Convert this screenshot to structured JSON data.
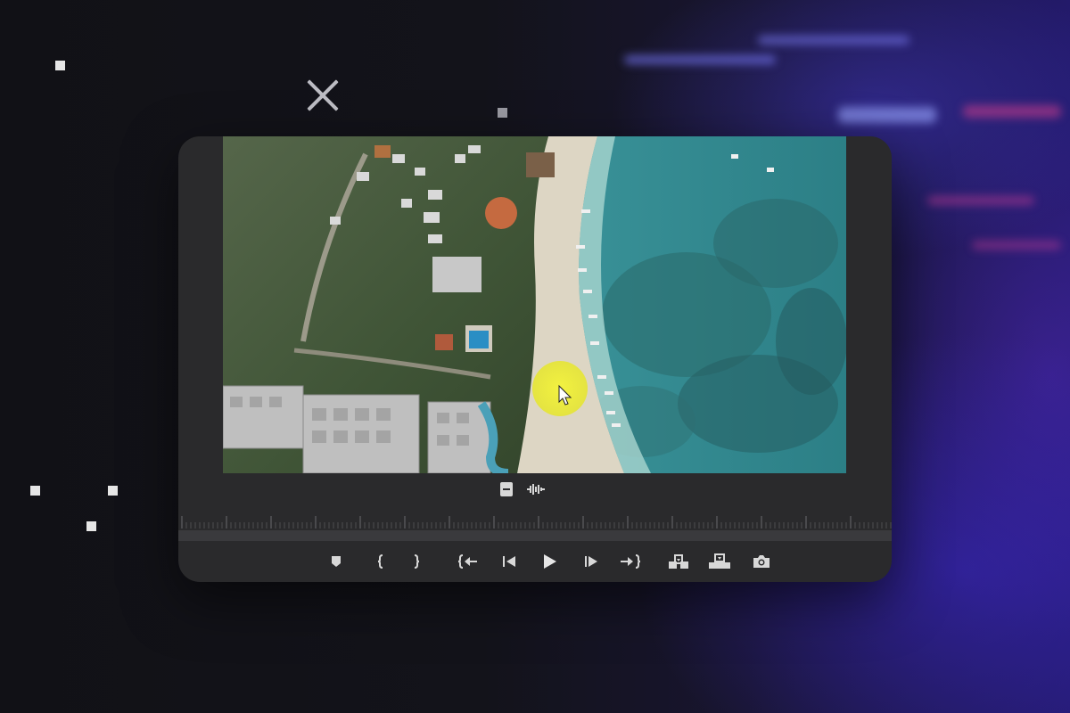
{
  "window": {
    "close_icon": "close-icon"
  },
  "player": {
    "video_description_icon": "aerial-beach-video-frame",
    "cursor_highlight_color": "#e6e62a",
    "view_toggles": [
      {
        "name": "video-only-toggle",
        "icon": "film-frame-icon"
      },
      {
        "name": "audio-only-toggle",
        "icon": "waveform-icon"
      }
    ],
    "transport_controls": [
      {
        "name": "add-marker-button",
        "icon": "marker-icon"
      },
      {
        "name": "mark-in-button",
        "icon": "mark-in-icon"
      },
      {
        "name": "mark-out-button",
        "icon": "mark-out-icon"
      },
      {
        "name": "go-to-in-button",
        "icon": "go-to-in-icon"
      },
      {
        "name": "step-back-button",
        "icon": "step-back-icon"
      },
      {
        "name": "play-button",
        "icon": "play-icon"
      },
      {
        "name": "step-forward-button",
        "icon": "step-forward-icon"
      },
      {
        "name": "go-to-out-button",
        "icon": "go-to-out-icon"
      },
      {
        "name": "insert-button",
        "icon": "insert-icon"
      },
      {
        "name": "overwrite-button",
        "icon": "overwrite-icon"
      },
      {
        "name": "export-frame-button",
        "icon": "camera-icon"
      }
    ]
  },
  "colors": {
    "panel": "#2a2a2c",
    "icon": "#d8d8d8",
    "accent_blue": "#3d2bd1"
  }
}
